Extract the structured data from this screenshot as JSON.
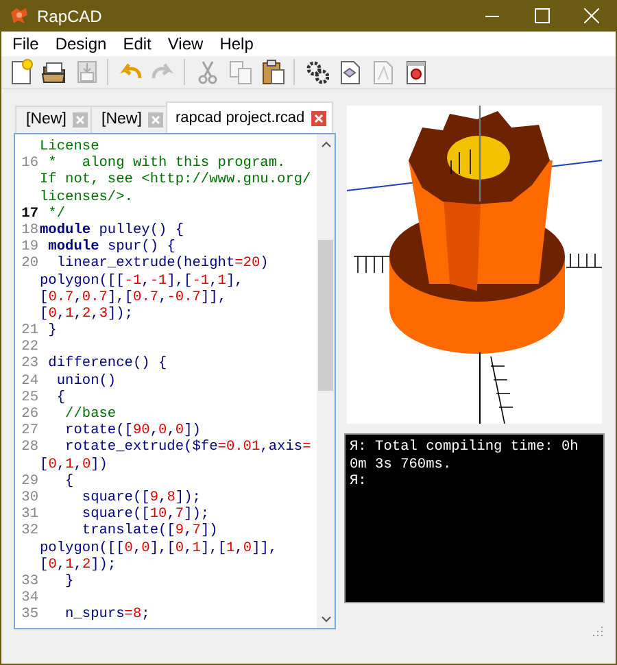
{
  "window": {
    "title": "RapCAD"
  },
  "menu": [
    "File",
    "Design",
    "Edit",
    "View",
    "Help"
  ],
  "toolbar": [
    {
      "kind": "new",
      "disabled": false
    },
    {
      "kind": "open",
      "disabled": false
    },
    {
      "kind": "save",
      "disabled": true
    },
    {
      "kind": "separator"
    },
    {
      "kind": "undo",
      "disabled": false
    },
    {
      "kind": "redo",
      "disabled": true
    },
    {
      "kind": "separator"
    },
    {
      "kind": "cut",
      "disabled": true
    },
    {
      "kind": "copy",
      "disabled": true
    },
    {
      "kind": "paste",
      "disabled": false
    },
    {
      "kind": "separator"
    },
    {
      "kind": "compile",
      "disabled": false
    },
    {
      "kind": "render",
      "disabled": false
    },
    {
      "kind": "export",
      "disabled": true
    },
    {
      "kind": "print",
      "disabled": false
    }
  ],
  "tabs": [
    {
      "label": "[New]",
      "selected": false
    },
    {
      "label": "[New]",
      "selected": false
    },
    {
      "label": "rapcad project.rcad",
      "selected": true
    }
  ],
  "editor": {
    "lines": [
      {
        "segments": [
          {
            "kind": "comment",
            "text": "License"
          }
        ]
      },
      {
        "number": "16",
        "current": false,
        "segments": [
          {
            "kind": "comment",
            "text": " *   along with this program."
          }
        ]
      },
      {
        "segments": [
          {
            "kind": "comment",
            "text": "If not, see <http://www.gnu.org/"
          }
        ]
      },
      {
        "segments": [
          {
            "kind": "comment",
            "text": "licenses/>."
          }
        ]
      },
      {
        "number": "17",
        "current": true,
        "segments": [
          {
            "kind": "comment",
            "text": " */"
          }
        ]
      },
      {
        "number": "18",
        "current": false,
        "segments": [
          {
            "kind": "keyword",
            "text": "module"
          },
          {
            "kind": "plain",
            "text": " pulley() {"
          }
        ]
      },
      {
        "number": "19",
        "current": false,
        "segments": [
          {
            "kind": "keyword",
            "text": " module"
          },
          {
            "kind": "plain",
            "text": " spur() {"
          }
        ]
      },
      {
        "number": "20",
        "current": false,
        "segments": [
          {
            "kind": "plain",
            "text": "  linear_extrude(height"
          },
          {
            "kind": "number",
            "text": "=20"
          },
          {
            "kind": "plain",
            "text": ")"
          }
        ]
      },
      {
        "segments": [
          {
            "kind": "plain",
            "text": "polygon([["
          },
          {
            "kind": "number",
            "text": "-1"
          },
          {
            "kind": "plain",
            "text": ","
          },
          {
            "kind": "number",
            "text": "-1"
          },
          {
            "kind": "plain",
            "text": "],["
          },
          {
            "kind": "number",
            "text": "-1"
          },
          {
            "kind": "plain",
            "text": ","
          },
          {
            "kind": "number",
            "text": "1"
          },
          {
            "kind": "plain",
            "text": "],"
          }
        ]
      },
      {
        "segments": [
          {
            "kind": "plain",
            "text": "["
          },
          {
            "kind": "number",
            "text": "0.7"
          },
          {
            "kind": "plain",
            "text": ","
          },
          {
            "kind": "number",
            "text": "0.7"
          },
          {
            "kind": "plain",
            "text": "],["
          },
          {
            "kind": "number",
            "text": "0.7"
          },
          {
            "kind": "plain",
            "text": ","
          },
          {
            "kind": "number",
            "text": "-0.7"
          },
          {
            "kind": "plain",
            "text": "]],"
          }
        ]
      },
      {
        "segments": [
          {
            "kind": "plain",
            "text": "["
          },
          {
            "kind": "number",
            "text": "0"
          },
          {
            "kind": "plain",
            "text": ","
          },
          {
            "kind": "number",
            "text": "1"
          },
          {
            "kind": "plain",
            "text": ","
          },
          {
            "kind": "number",
            "text": "2"
          },
          {
            "kind": "plain",
            "text": ","
          },
          {
            "kind": "number",
            "text": "3"
          },
          {
            "kind": "plain",
            "text": "]);"
          }
        ]
      },
      {
        "number": "21",
        "current": false,
        "segments": [
          {
            "kind": "plain",
            "text": " }"
          }
        ]
      },
      {
        "number": "22",
        "current": false
      },
      {
        "number": "23",
        "current": false,
        "segments": [
          {
            "kind": "plain",
            "text": " difference() {"
          }
        ]
      },
      {
        "number": "24",
        "current": false,
        "segments": [
          {
            "kind": "plain",
            "text": "  union()"
          }
        ]
      },
      {
        "number": "25",
        "current": false,
        "segments": [
          {
            "kind": "plain",
            "text": "  {"
          }
        ]
      },
      {
        "number": "26",
        "current": false,
        "segments": [
          {
            "kind": "comment",
            "text": "   //base"
          }
        ]
      },
      {
        "number": "27",
        "current": false,
        "segments": [
          {
            "kind": "plain",
            "text": "   rotate(["
          },
          {
            "kind": "number",
            "text": "90"
          },
          {
            "kind": "plain",
            "text": ","
          },
          {
            "kind": "number",
            "text": "0"
          },
          {
            "kind": "plain",
            "text": ","
          },
          {
            "kind": "number",
            "text": "0"
          },
          {
            "kind": "plain",
            "text": "])"
          }
        ]
      },
      {
        "number": "28",
        "current": false,
        "segments": [
          {
            "kind": "plain",
            "text": "   rotate_extrude($fe"
          },
          {
            "kind": "number",
            "text": "=0.01"
          },
          {
            "kind": "plain",
            "text": ",axis"
          },
          {
            "kind": "number",
            "text": "="
          }
        ]
      },
      {
        "segments": [
          {
            "kind": "plain",
            "text": "["
          },
          {
            "kind": "number",
            "text": "0"
          },
          {
            "kind": "plain",
            "text": ","
          },
          {
            "kind": "number",
            "text": "1"
          },
          {
            "kind": "plain",
            "text": ","
          },
          {
            "kind": "number",
            "text": "0"
          },
          {
            "kind": "plain",
            "text": "])"
          }
        ]
      },
      {
        "number": "29",
        "current": false,
        "segments": [
          {
            "kind": "plain",
            "text": "   {"
          }
        ]
      },
      {
        "number": "30",
        "current": false,
        "segments": [
          {
            "kind": "plain",
            "text": "     square(["
          },
          {
            "kind": "number",
            "text": "9"
          },
          {
            "kind": "plain",
            "text": ","
          },
          {
            "kind": "number",
            "text": "8"
          },
          {
            "kind": "plain",
            "text": "]);"
          }
        ]
      },
      {
        "number": "31",
        "current": false,
        "segments": [
          {
            "kind": "plain",
            "text": "     square(["
          },
          {
            "kind": "number",
            "text": "10"
          },
          {
            "kind": "plain",
            "text": ","
          },
          {
            "kind": "number",
            "text": "7"
          },
          {
            "kind": "plain",
            "text": "]);"
          }
        ]
      },
      {
        "number": "32",
        "current": false,
        "segments": [
          {
            "kind": "plain",
            "text": "     translate(["
          },
          {
            "kind": "number",
            "text": "9"
          },
          {
            "kind": "plain",
            "text": ","
          },
          {
            "kind": "number",
            "text": "7"
          },
          {
            "kind": "plain",
            "text": "])"
          }
        ]
      },
      {
        "segments": [
          {
            "kind": "plain",
            "text": "polygon([["
          },
          {
            "kind": "number",
            "text": "0"
          },
          {
            "kind": "plain",
            "text": ","
          },
          {
            "kind": "number",
            "text": "0"
          },
          {
            "kind": "plain",
            "text": "],["
          },
          {
            "kind": "number",
            "text": "0"
          },
          {
            "kind": "plain",
            "text": ","
          },
          {
            "kind": "number",
            "text": "1"
          },
          {
            "kind": "plain",
            "text": "],["
          },
          {
            "kind": "number",
            "text": "1"
          },
          {
            "kind": "plain",
            "text": ","
          },
          {
            "kind": "number",
            "text": "0"
          },
          {
            "kind": "plain",
            "text": "]],"
          }
        ]
      },
      {
        "segments": [
          {
            "kind": "plain",
            "text": "["
          },
          {
            "kind": "number",
            "text": "0"
          },
          {
            "kind": "plain",
            "text": ","
          },
          {
            "kind": "number",
            "text": "1"
          },
          {
            "kind": "plain",
            "text": ","
          },
          {
            "kind": "number",
            "text": "2"
          },
          {
            "kind": "plain",
            "text": "]);"
          }
        ]
      },
      {
        "number": "33",
        "current": false,
        "segments": [
          {
            "kind": "plain",
            "text": "   }"
          }
        ]
      },
      {
        "number": "34",
        "current": false
      },
      {
        "number": "35",
        "current": false,
        "segments": [
          {
            "kind": "plain",
            "text": "   n_spurs"
          },
          {
            "kind": "number",
            "text": "=8"
          },
          {
            "kind": "plain",
            "text": ";"
          }
        ]
      }
    ]
  },
  "console": [
    "Я: Total compiling time: 0h 0m 3s 760ms.",
    "Я:"
  ]
}
